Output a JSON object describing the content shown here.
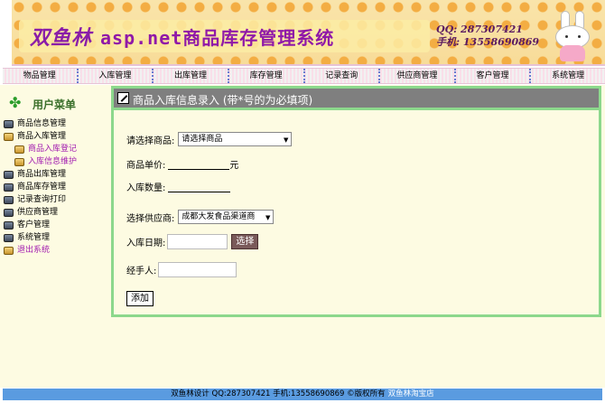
{
  "banner": {
    "brand": "双鱼林",
    "title": "asp.net商品库存管理系统",
    "qq": "QQ: 287307421",
    "phone": "手机: 13558690869"
  },
  "nav": [
    "物品管理",
    "入库管理",
    "出库管理",
    "库存管理",
    "记录查询",
    "供应商管理",
    "客户管理",
    "系统管理"
  ],
  "sidebar": {
    "title": "用户菜单",
    "items": [
      {
        "label": "商品信息管理",
        "icon": "closed-book-icon"
      },
      {
        "label": "商品入库管理",
        "icon": "open-folder-icon"
      },
      {
        "label": "商品入库登记",
        "icon": "open-folder-icon",
        "child": true
      },
      {
        "label": "入库信息维护",
        "icon": "open-folder-icon",
        "child": true
      },
      {
        "label": "商品出库管理",
        "icon": "closed-book-icon"
      },
      {
        "label": "商品库存管理",
        "icon": "closed-book-icon"
      },
      {
        "label": "记录查询打印",
        "icon": "closed-book-icon"
      },
      {
        "label": "供应商管理",
        "icon": "closed-book-icon"
      },
      {
        "label": "客户管理",
        "icon": "closed-book-icon"
      },
      {
        "label": "系统管理",
        "icon": "closed-book-icon"
      },
      {
        "label": "退出系统",
        "icon": "open-folder-icon",
        "exit": true
      }
    ]
  },
  "form": {
    "heading": "商品入库信息录入 (带*号的为必填项)",
    "product_label": "请选择商品:",
    "product_value": "请选择商品",
    "price_label": "商品单价:",
    "price_unit": "元",
    "qty_label": "入库数量:",
    "supplier_label": "选择供应商:",
    "supplier_value": "成都大发食品渠道商",
    "date_label": "入库日期:",
    "date_button": "选择",
    "handler_label": "经手人:",
    "submit": "添加"
  },
  "footer": {
    "text": "双鱼林设计 QQ:287307421 手机:13558690869 ©版权所有",
    "store": "双鱼林淘宝店"
  }
}
